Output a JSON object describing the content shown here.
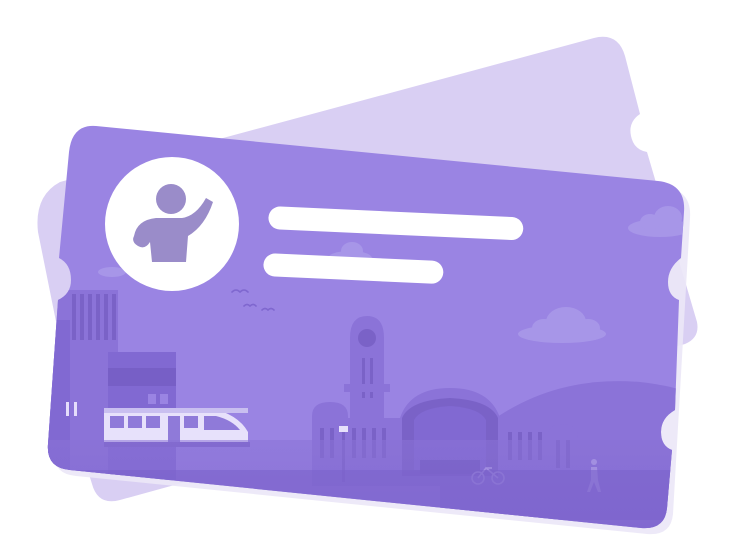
{
  "illustration": {
    "subject": "travel card",
    "colors": {
      "background": "#ffffff",
      "back_card": "#d9cff3",
      "front_card": "#9a84e3",
      "front_card_shadow": "#e6e1f5",
      "skyline": "#8b73d8",
      "skyline_dark": "#7a62c7",
      "ground": "#7f67cf",
      "avatar_circle": "#ffffff",
      "avatar_figure": "#9a8cc9",
      "text_placeholder": "#ffffff",
      "cloud": "#a796e8",
      "tram": "#e7e1fb"
    },
    "icons": [
      "person-waving-icon",
      "tram-icon",
      "bicycle-icon",
      "pedestrian-icon",
      "birds-icon",
      "cloud-icon"
    ],
    "placeholder_lines": 2
  }
}
